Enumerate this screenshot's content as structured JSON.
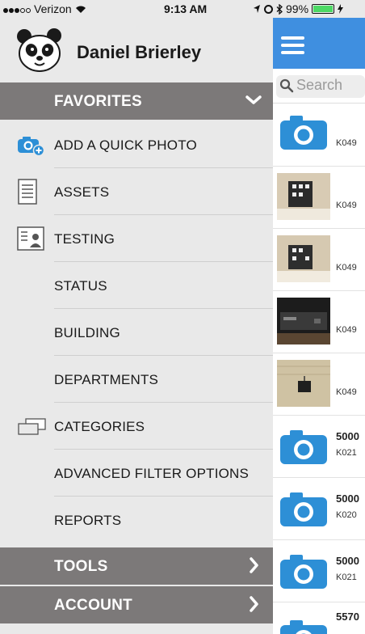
{
  "status_bar": {
    "carrier": "Verizon",
    "time": "9:13 AM",
    "battery": "99%"
  },
  "profile": {
    "name": "Daniel Brierley",
    "avatar_icon": "panda-avatar-icon"
  },
  "sections": {
    "favorites": "FAVORITES",
    "tools": "TOOLS",
    "account": "ACCOUNT"
  },
  "menu": [
    {
      "label": "ADD A QUICK PHOTO",
      "icon": "camera-add-icon"
    },
    {
      "label": "ASSETS",
      "icon": "document-icon"
    },
    {
      "label": "TESTING",
      "icon": "id-card-icon"
    },
    {
      "label": "STATUS",
      "icon": ""
    },
    {
      "label": "BUILDING",
      "icon": ""
    },
    {
      "label": "DEPARTMENTS",
      "icon": ""
    },
    {
      "label": "CATEGORIES",
      "icon": "categories-icon"
    },
    {
      "label": "ADVANCED FILTER OPTIONS",
      "icon": ""
    },
    {
      "label": "REPORTS",
      "icon": ""
    }
  ],
  "search": {
    "placeholder": "Search"
  },
  "list": [
    {
      "kind": "camera",
      "title": "",
      "code": "K049"
    },
    {
      "kind": "photo-wall",
      "title": "",
      "code": "K049"
    },
    {
      "kind": "photo-wall",
      "title": "",
      "code": "K049"
    },
    {
      "kind": "photo-dark",
      "title": "",
      "code": "K049"
    },
    {
      "kind": "photo-ceiling",
      "title": "",
      "code": "K049"
    },
    {
      "kind": "camera",
      "title": "5000",
      "code": "K021"
    },
    {
      "kind": "camera",
      "title": "5000",
      "code": "K020"
    },
    {
      "kind": "camera",
      "title": "5000",
      "code": "K021"
    },
    {
      "kind": "camera",
      "title": "5570",
      "code": ""
    }
  ],
  "colors": {
    "header_blue": "#3f8fe0",
    "section_gray": "#7c7979",
    "camera_blue": "#2d8fd6",
    "battery_green": "#4cd964"
  }
}
